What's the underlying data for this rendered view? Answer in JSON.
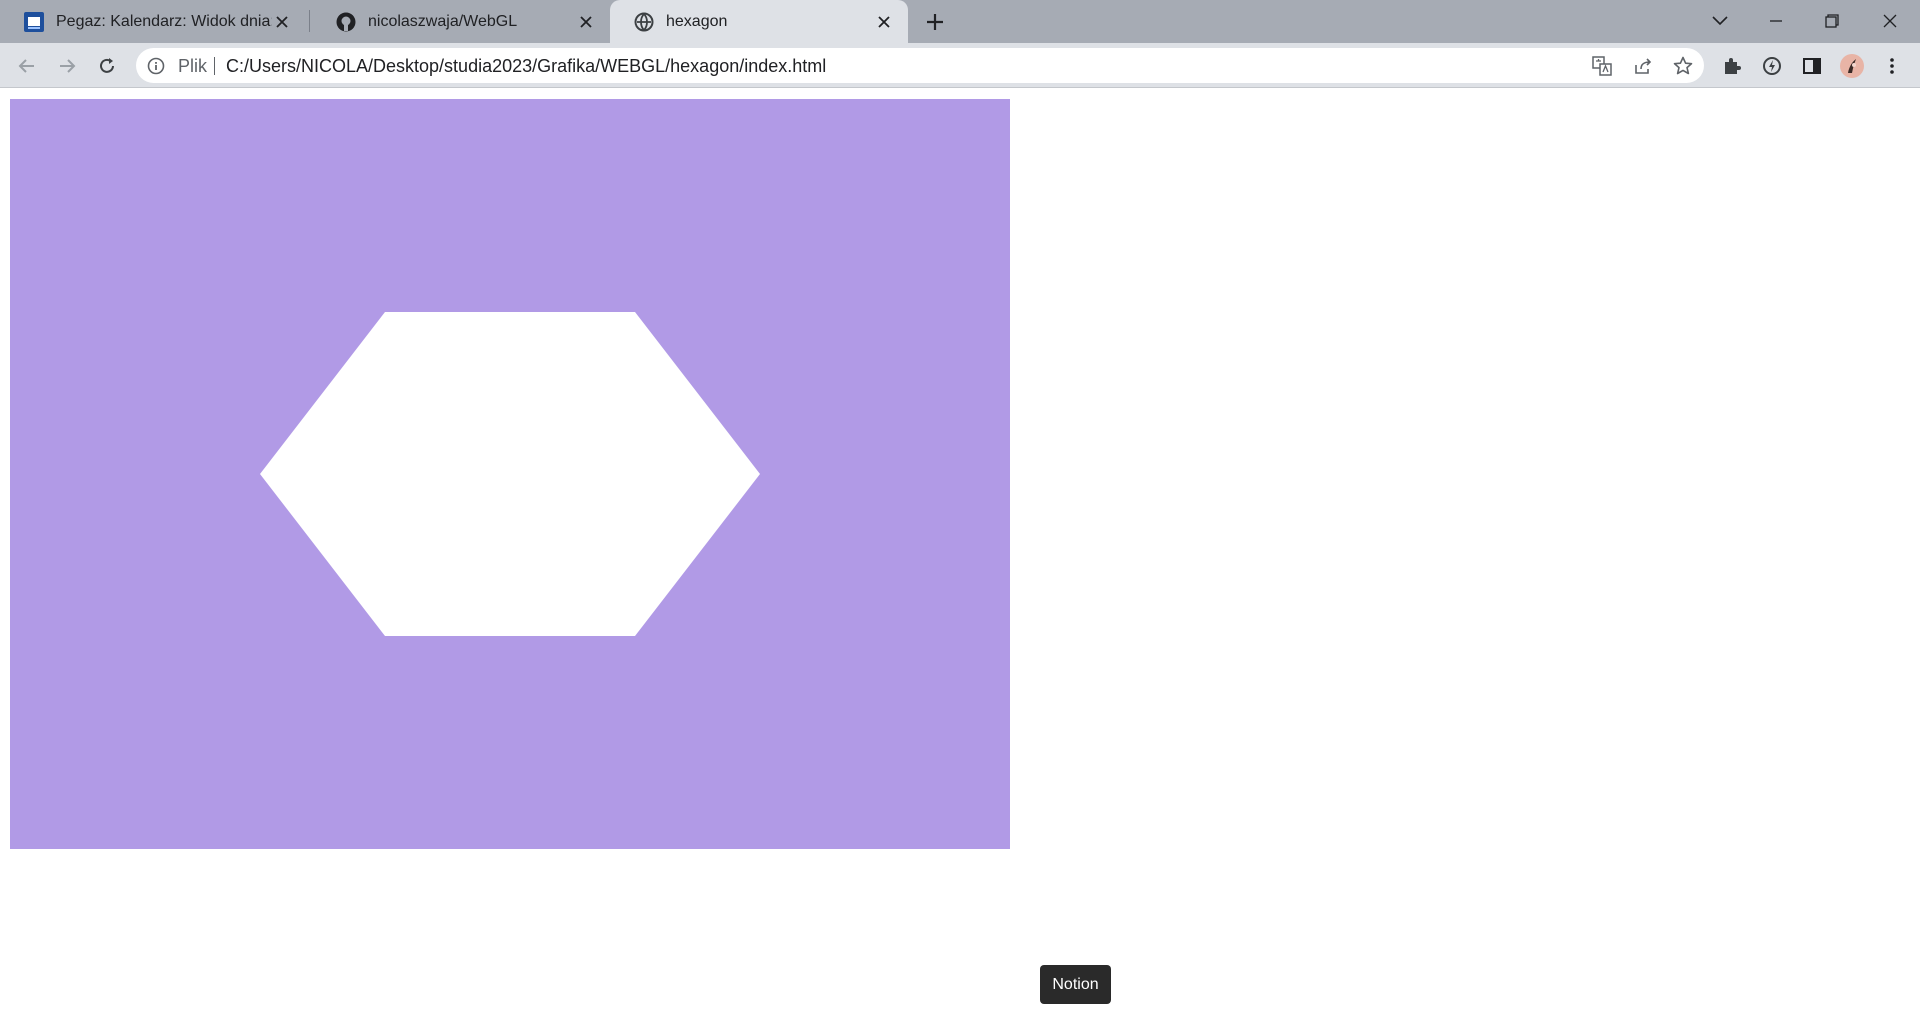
{
  "browser": {
    "tabs": [
      {
        "title": "Pegaz: Kalendarz: Widok dnia: śro",
        "icon": "pegaz-favicon-icon",
        "active": false
      },
      {
        "title": "nicolaszwaja/WebGL",
        "icon": "github-icon",
        "active": false
      },
      {
        "title": "hexagon",
        "icon": "globe-icon",
        "active": true
      }
    ],
    "address": {
      "scheme": "Plik",
      "url": "C:/Users/NICOLA/Desktop/studia2023/Grafika/WEBGL/hexagon/index.html"
    }
  },
  "page": {
    "canvas": {
      "background": "#b19ae6",
      "shape_color": "#ffffff",
      "shape": "hexagon"
    }
  },
  "tooltip": {
    "text": "Notion"
  }
}
